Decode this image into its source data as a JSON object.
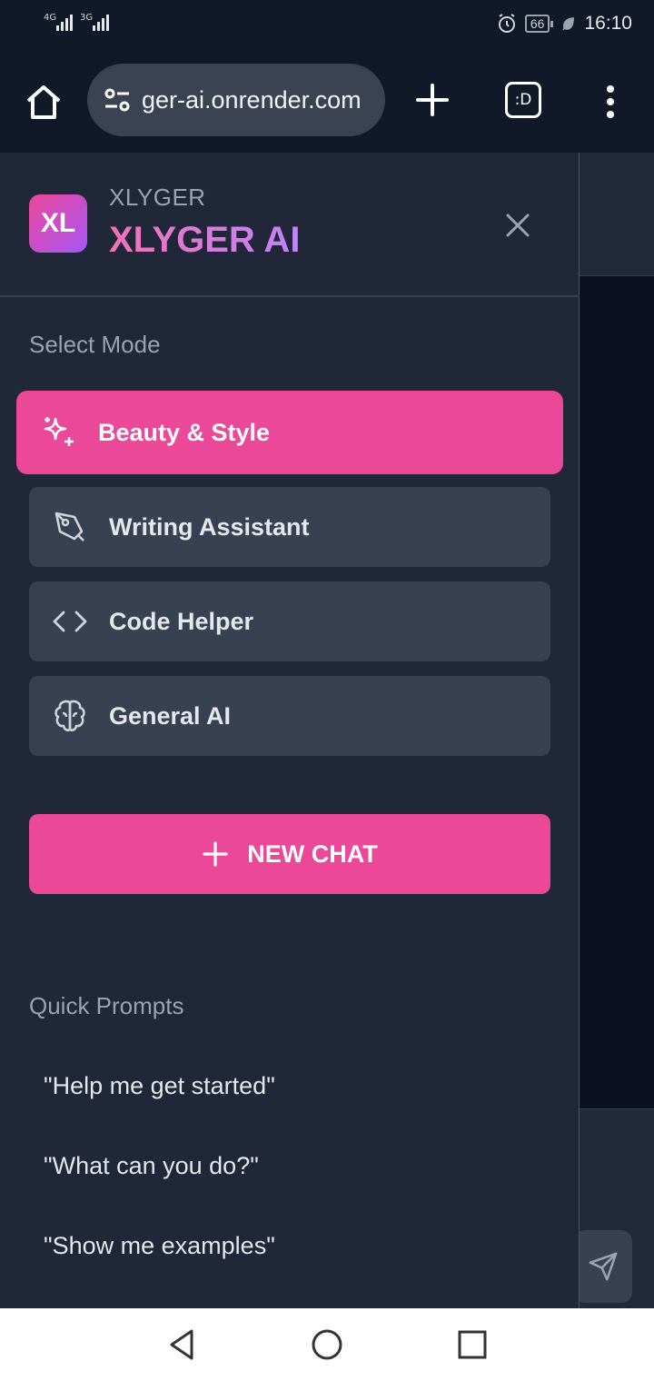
{
  "status_bar": {
    "signal1_label": "4G",
    "signal2_label": "3G",
    "battery": "66",
    "time": "16:10",
    "icons": [
      "alarm-icon",
      "battery-icon",
      "leaf-icon"
    ]
  },
  "browser": {
    "url": "ger-ai.onrender.com",
    "tabs_label": ":D",
    "icons": [
      "home-icon",
      "site-settings-icon",
      "plus-icon",
      "tabs-icon",
      "more-vert-icon"
    ]
  },
  "drawer": {
    "brand_small": "XLYGER",
    "brand_title": "XLYGER AI",
    "logo_text": "XL",
    "select_mode_label": "Select Mode",
    "modes": [
      {
        "label": "Beauty & Style",
        "icon": "sparkles-icon",
        "active": true
      },
      {
        "label": "Writing Assistant",
        "icon": "pen-tool-icon",
        "active": false
      },
      {
        "label": "Code Helper",
        "icon": "code-icon",
        "active": false
      },
      {
        "label": "General AI",
        "icon": "brain-icon",
        "active": false
      }
    ],
    "new_chat_label": "NEW CHAT",
    "quick_prompts_label": "Quick Prompts",
    "quick_prompts": [
      "\"Help me get started\"",
      "\"What can you do?\"",
      "\"Show me examples\""
    ]
  },
  "colors": {
    "accent": "#ec4899",
    "drawer_bg": "#1f2738",
    "item_bg": "#374151",
    "browser_bg": "#111827"
  }
}
